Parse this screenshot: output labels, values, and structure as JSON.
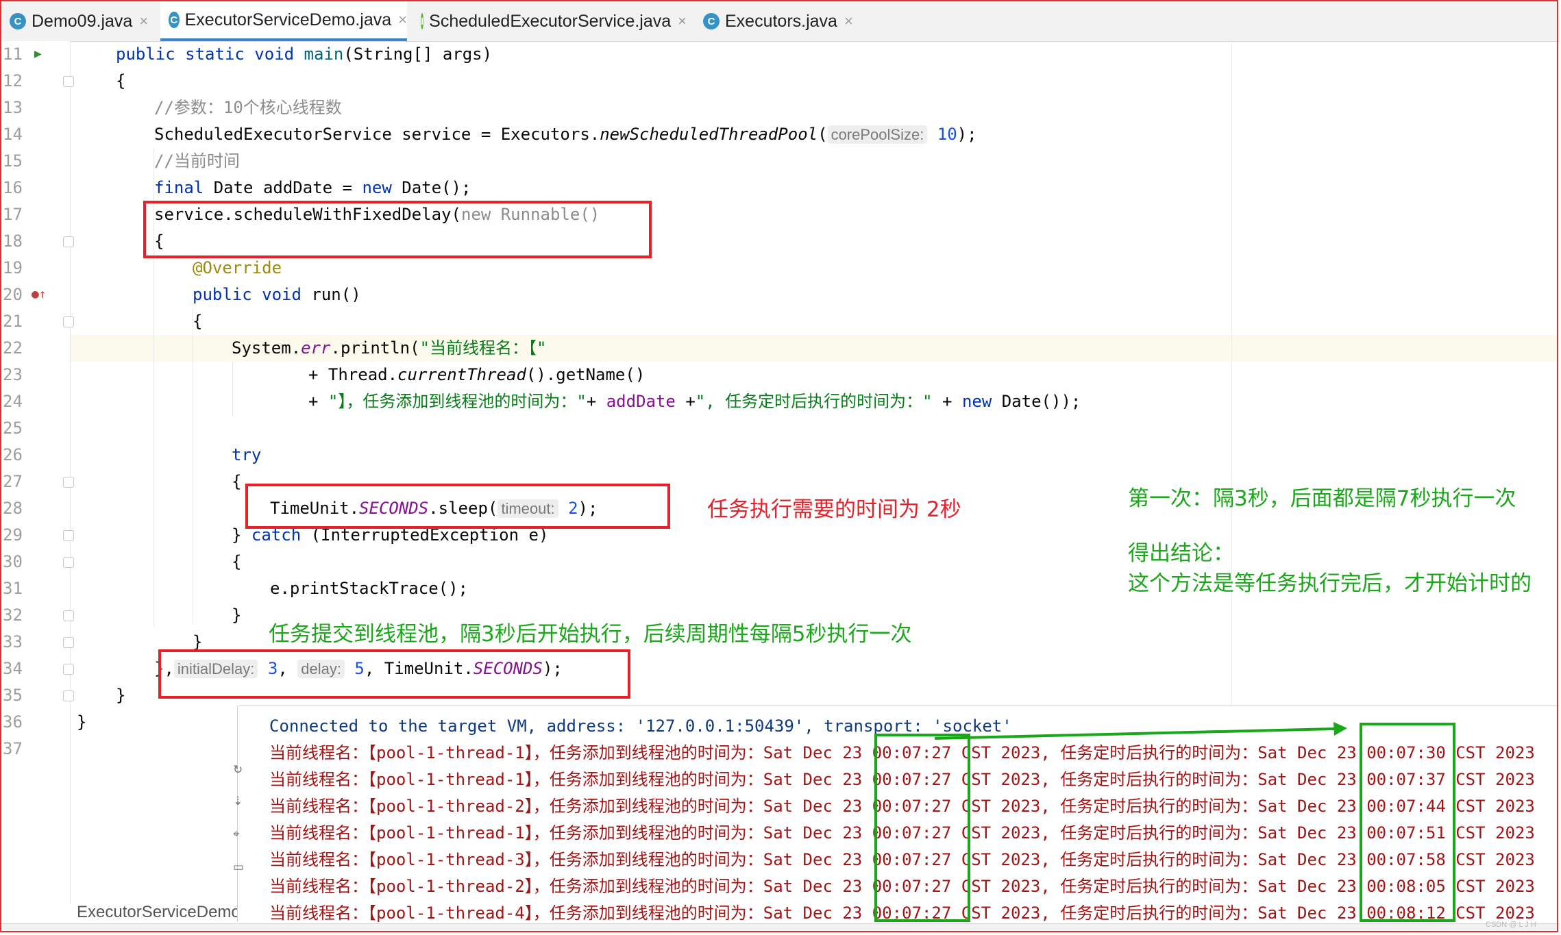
{
  "tabs": [
    {
      "label": "Demo09.java",
      "icon": "C"
    },
    {
      "label": "ExecutorServiceDemo.java",
      "icon": "C"
    },
    {
      "label": "ScheduledExecutorService.java",
      "icon": "I"
    },
    {
      "label": "Executors.java",
      "icon": "C"
    }
  ],
  "gutter": {
    "line_numbers": [
      "11",
      "12",
      "13",
      "14",
      "15",
      "16",
      "17",
      "18",
      "19",
      "20",
      "21",
      "22",
      "23",
      "24",
      "25",
      "26",
      "27",
      "28",
      "29",
      "30",
      "31",
      "32",
      "33",
      "34",
      "35",
      "36",
      "37"
    ]
  },
  "code": {
    "l11_a": "public static void ",
    "l11_b": "main",
    "l11_c": "(String[] args)",
    "l12": "{",
    "l13": "//参数：10个核心线程数",
    "l14_a": "ScheduledExecutorService service = Executors.",
    "l14_b": "newScheduledThreadPool",
    "l14_c": "(",
    "l14_hint": "corePoolSize:",
    "l14_num": "10",
    "l14_d": ");",
    "l15": "//当前时间",
    "l16_a": "final",
    "l16_b": " Date addDate = ",
    "l16_c": "new",
    "l16_d": " Date();",
    "l17_a": "service.scheduleWithFixedDelay(",
    "l17_b": "new Runnable()",
    "l18": "{",
    "l19": "@Override",
    "l20_a": "public void ",
    "l20_b": "run()",
    "l21": "{",
    "l22_a": "System.",
    "l22_b": "err",
    "l22_c": ".println(",
    "l22_d": "\"当前线程名：【\"",
    "l23_a": "+ Thread.",
    "l23_b": "currentThread",
    "l23_c": "().getName()",
    "l24_a": "+ ",
    "l24_b": "\"】，任务添加到线程池的时间为：\"",
    "l24_c": "+ ",
    "l24_d": "addDate",
    "l24_e": " +",
    "l24_f": "\", 任务定时后执行的时间为：\"",
    "l24_g": " + ",
    "l24_h": "new",
    "l24_i": " Date());",
    "l26": "try",
    "l27": "{",
    "l28_a": "TimeUnit.",
    "l28_b": "SECONDS",
    "l28_c": ".sleep(",
    "l28_hint": "timeout:",
    "l28_num": "2",
    "l28_d": ");",
    "l29_a": "} ",
    "l29_b": "catch",
    "l29_c": " (InterruptedException e)",
    "l30": "{",
    "l31": "e.printStackTrace();",
    "l32": "}",
    "l33": "}",
    "l34_a": "},",
    "l34_hint1": "initialDelay:",
    "l34_num1": "3",
    "l34_sep": ",",
    "l34_hint2": "delay:",
    "l34_num2": "5",
    "l34_b": ", TimeUnit.",
    "l34_c": "SECONDS",
    "l34_d": ");",
    "l35": "}",
    "l36": "}"
  },
  "annotations": {
    "task_time": "任务执行需要的时间为 2秒",
    "submit_note": "任务提交到线程池，隔3秒后开始执行，后续周期性每隔5秒执行一次",
    "first_note": "第一次：隔3秒，后面都是隔7秒执行一次",
    "conclusion_title": "得出结论：",
    "conclusion_body": "这个方法是等任务执行完后，才开始计时的"
  },
  "console": {
    "connected": "Connected to the target VM, address: '127.0.0.1:50439', transport: 'socket'",
    "rows": [
      {
        "thread": "pool-1-thread-1",
        "added": "00:07:27",
        "run": "00:07:30"
      },
      {
        "thread": "pool-1-thread-1",
        "added": "00:07:27",
        "run": "00:07:37"
      },
      {
        "thread": "pool-1-thread-2",
        "added": "00:07:27",
        "run": "00:07:44"
      },
      {
        "thread": "pool-1-thread-1",
        "added": "00:07:27",
        "run": "00:07:51"
      },
      {
        "thread": "pool-1-thread-3",
        "added": "00:07:27",
        "run": "00:07:58"
      },
      {
        "thread": "pool-1-thread-2",
        "added": "00:07:27",
        "run": "00:08:05"
      },
      {
        "thread": "pool-1-thread-4",
        "added": "00:07:27",
        "run": "00:08:12"
      }
    ],
    "prefix": "当前线程名：【",
    "mid": "】，任务添加到线程池的时间为：Sat Dec 23 ",
    "mid2": " CST 2023, 任务定时后执行的时间为：Sat Dec 23 ",
    "tail": " CST 2023"
  },
  "bottom": {
    "file_tab": "ExecutorServiceDemo"
  },
  "watermark": "CSDN @ L J H",
  "colors": {
    "keyword": "#0033b3",
    "string": "#067d17",
    "comment": "#8c8c8c",
    "annotation_red": "#e8202a",
    "annotation_green": "#1aa81a"
  }
}
